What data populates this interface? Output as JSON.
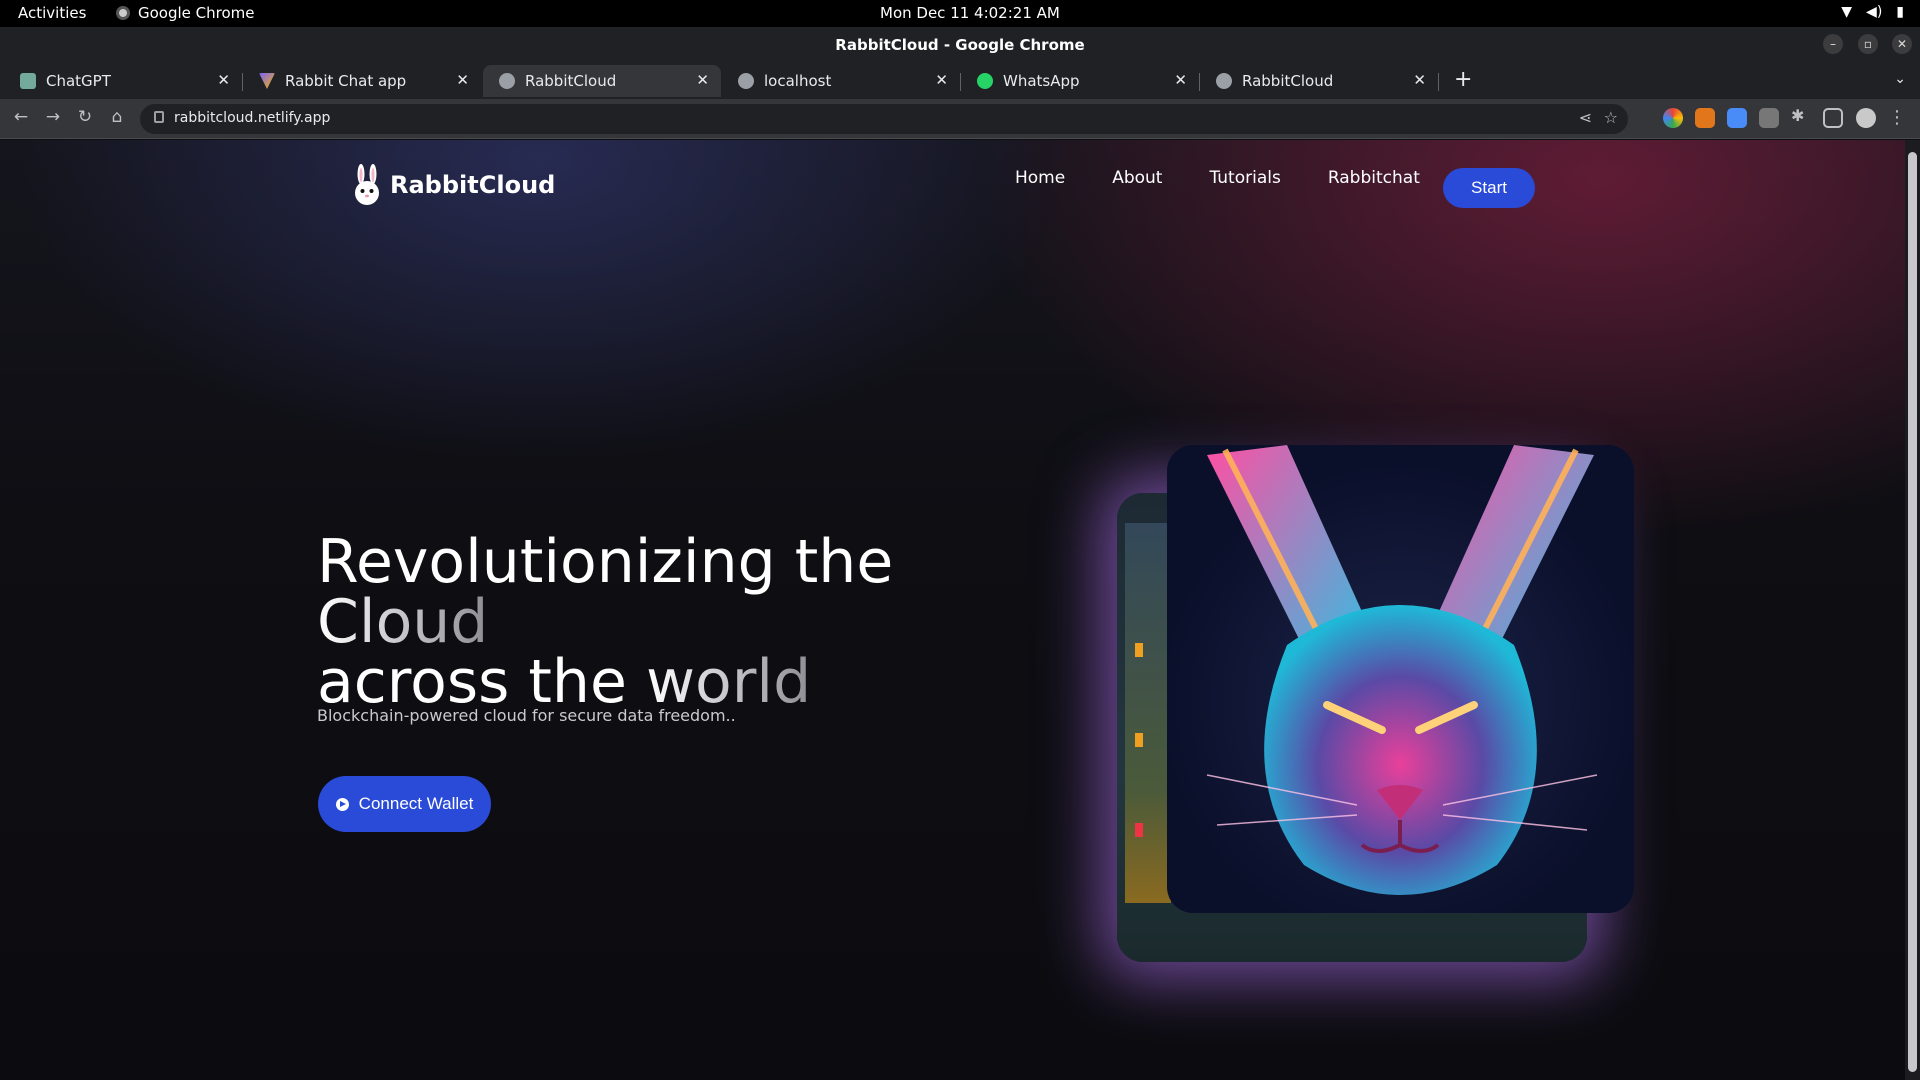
{
  "system": {
    "activities": "Activities",
    "app_name": "Google Chrome",
    "clock": "Mon Dec 11  4:02:21 AM"
  },
  "window": {
    "title": "RabbitCloud - Google Chrome"
  },
  "tabs": [
    {
      "label": "ChatGPT",
      "favicon_color": "#74aa9c"
    },
    {
      "label": "Rabbit Chat app",
      "favicon_color": "#f5b400"
    },
    {
      "label": "RabbitCloud",
      "favicon_color": "#9aa0a6"
    },
    {
      "label": "localhost",
      "favicon_color": "#9aa0a6"
    },
    {
      "label": "WhatsApp",
      "favicon_color": "#25d366"
    },
    {
      "label": "RabbitCloud",
      "favicon_color": "#9aa0a6"
    }
  ],
  "omnibox": {
    "url": "rabbitcloud.netlify.app"
  },
  "page": {
    "brand": "RabbitCloud",
    "nav": [
      "Home",
      "About",
      "Tutorials",
      "Rabbitchat"
    ],
    "start_label": "Start",
    "headline_line1_a": "Revolutionizing the ",
    "headline_line1_b": "Cloud",
    "headline_line2_a": "across the ",
    "headline_line2_b": "world",
    "subtitle": "Blockchain-powered cloud for secure data freedom..",
    "connect_label": "Connect Wallet"
  },
  "colors": {
    "accent": "#2a4ad8",
    "glow": "#ba78ff",
    "background": "#0d0d12"
  }
}
